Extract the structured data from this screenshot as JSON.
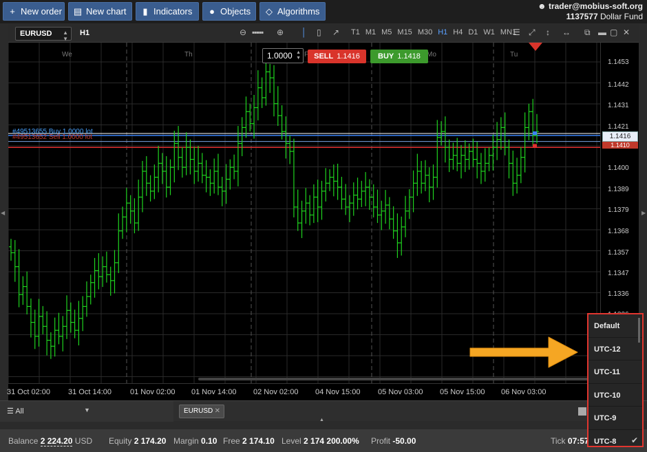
{
  "toolbar": {
    "new_order": "New order",
    "new_chart": "New chart",
    "indicators": "Indicators",
    "objects": "Objects",
    "algorithms": "Algorithms"
  },
  "account": {
    "user": "trader@mobius-soft.org",
    "number": "1137577",
    "fund": "Dollar Fund"
  },
  "chart": {
    "symbol": "EURUSD",
    "timeframe": "H1",
    "timeframes": [
      "T1",
      "M1",
      "M5",
      "M15",
      "M30",
      "H1",
      "H4",
      "D1",
      "W1",
      "MN1"
    ],
    "active_timeframe": "H1",
    "lot": "1.0000",
    "sell_label": "SELL",
    "sell_price": "1.1416",
    "buy_label": "BUY",
    "buy_price": "1.1418",
    "order_buy": "#49513655 Buy 1.0000 lot",
    "order_sell": "#49513652 Sell 1.0000 lot",
    "current_price": "1.1416",
    "sell_price_box": "1.1410",
    "days": [
      "We",
      "Th",
      "Fr",
      "Mo",
      "Tu"
    ],
    "price_ticks": [
      "1.1453",
      "1.1442",
      "1.1431",
      "1.1421",
      "1.1410",
      "1.1400",
      "1.1389",
      "1.1379",
      "1.1368",
      "1.1357",
      "1.1347",
      "1.1336",
      "1.1326"
    ],
    "time_ticks": [
      "31 Oct 02:00",
      "31 Oct 14:00",
      "01 Nov 02:00",
      "01 Nov 14:00",
      "02 Nov 02:00",
      "04 Nov 15:00",
      "05 Nov 03:00",
      "05 Nov 15:00",
      "06 Nov 03:00"
    ]
  },
  "bottom": {
    "filter": "All",
    "tab": "EURUSD"
  },
  "status": {
    "balance_label": "Balance",
    "balance": "2 224.20",
    "currency": "USD",
    "equity_label": "Equity",
    "equity": "2 174.20",
    "margin_label": "Margin",
    "margin": "0.10",
    "free_label": "Free",
    "free": "2 174.10",
    "level_label": "Level",
    "level": "2 174 200.00%",
    "profit_label": "Profit",
    "profit": "-50.00",
    "tick_label": "Tick",
    "tick": "07:57"
  },
  "timezone_menu": {
    "items": [
      "Default",
      "UTC-12",
      "UTC-11",
      "UTC-10",
      "UTC-9",
      "UTC-8"
    ]
  },
  "colors": {
    "accent": "#3a5d8f",
    "sell": "#d9342b",
    "buy": "#3c9a2c",
    "candle": "#1fd41f",
    "highlight": "#e2362f",
    "pointer_arrow": "#f5a623"
  }
}
